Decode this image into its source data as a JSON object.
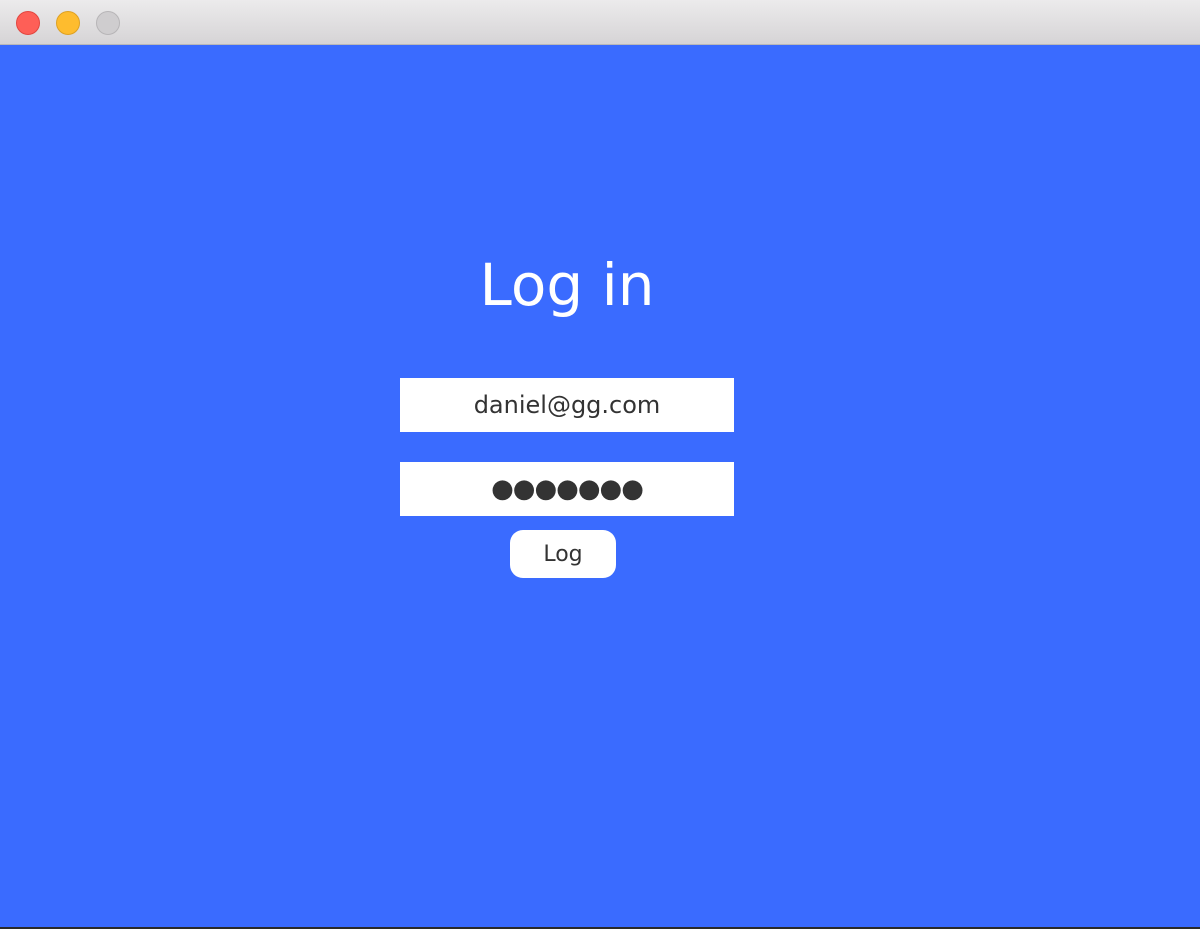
{
  "window": {
    "background_color": "#3a6bff",
    "controls": {
      "close_color": "#fe5f57",
      "minimize_color": "#febc2e",
      "zoom_color": "#cfcdcf"
    }
  },
  "login": {
    "title": "Log in",
    "email_value": "daniel@gg.com",
    "password_mask": "●●●●●●●",
    "submit_label": "Log"
  }
}
